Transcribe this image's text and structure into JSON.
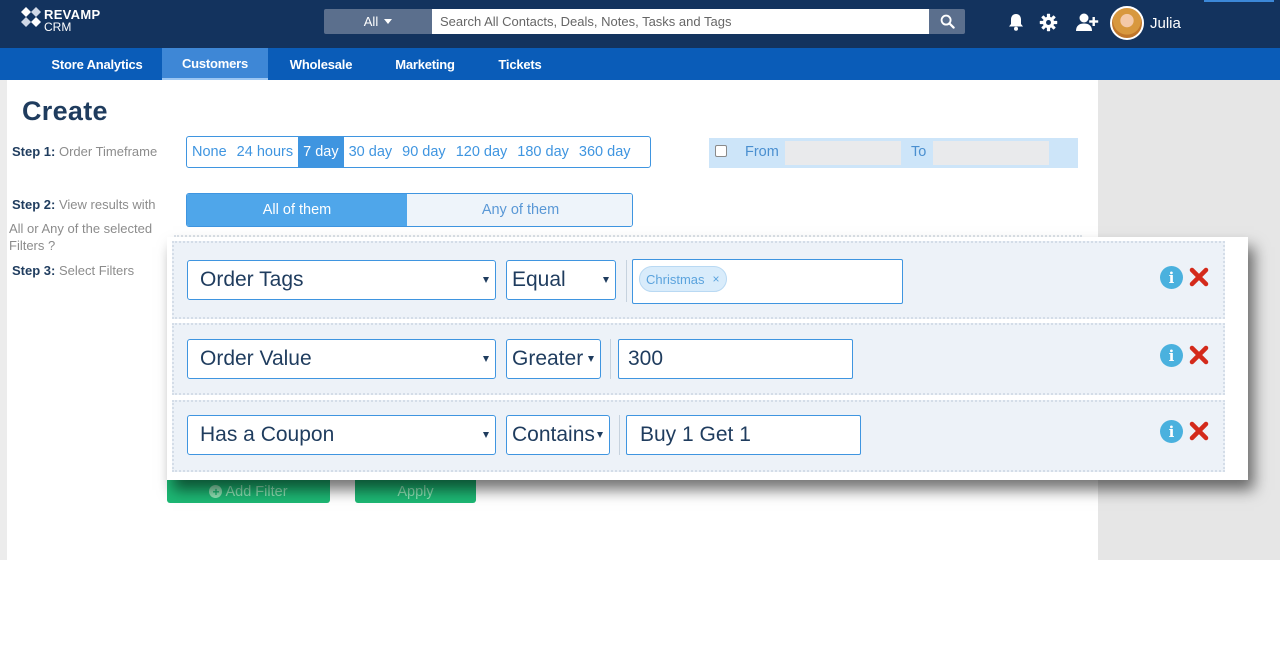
{
  "app": {
    "logo_line1": "REVAMP",
    "logo_line2": "CRM",
    "user_name": "Julia"
  },
  "search": {
    "scope": "All",
    "placeholder": "Search All Contacts, Deals, Notes, Tasks and Tags"
  },
  "nav": {
    "items": [
      {
        "label": "Store Analytics"
      },
      {
        "label": "Customers",
        "active": true
      },
      {
        "label": "Wholesale"
      },
      {
        "label": "Marketing"
      },
      {
        "label": "Tickets"
      }
    ]
  },
  "page": {
    "title": "Create",
    "step1_num": "Step 1:",
    "step1_text": "Order Timeframe",
    "step2_num": "Step 2:",
    "step2_text1": "View results with",
    "step2_text2": "All or Any of the selected",
    "step2_text3": "Filters ?",
    "step3_num": "Step 3:",
    "step3_text": "Select Filters"
  },
  "timeframe": {
    "options": [
      "None",
      "24 hours",
      "7 day",
      "30 day",
      "90 day",
      "120 day",
      "180 day",
      "360 day"
    ],
    "selected": "7 day"
  },
  "date_range": {
    "from_label": "From",
    "to_label": "To",
    "checked": false
  },
  "match_mode": {
    "all_label": "All of them",
    "any_label": "Any of them",
    "selected": "all"
  },
  "filters": [
    {
      "field": "Order Tags",
      "operator": "Equal",
      "tag": "Christmas",
      "tag_remove": "×"
    },
    {
      "field": "Order Value",
      "operator": "Greater",
      "value": "300"
    },
    {
      "field": "Has a Coupon",
      "operator": "Contains",
      "value": "Buy 1 Get 1"
    }
  ],
  "actions": {
    "add_filter": "Add Filter",
    "apply": "Apply"
  },
  "colors": {
    "topbar": "#13335e",
    "navbar": "#0a5cb8",
    "accent_blue": "#3f95e0",
    "green_button": "#1db874",
    "delete_red": "#d42a1b",
    "info_blue": "#4ab1de"
  },
  "icons": [
    "bell-icon",
    "gear-icon",
    "add-user-icon",
    "search-icon",
    "info-icon",
    "delete-icon",
    "plus-circle-icon",
    "chevron-down-icon"
  ]
}
